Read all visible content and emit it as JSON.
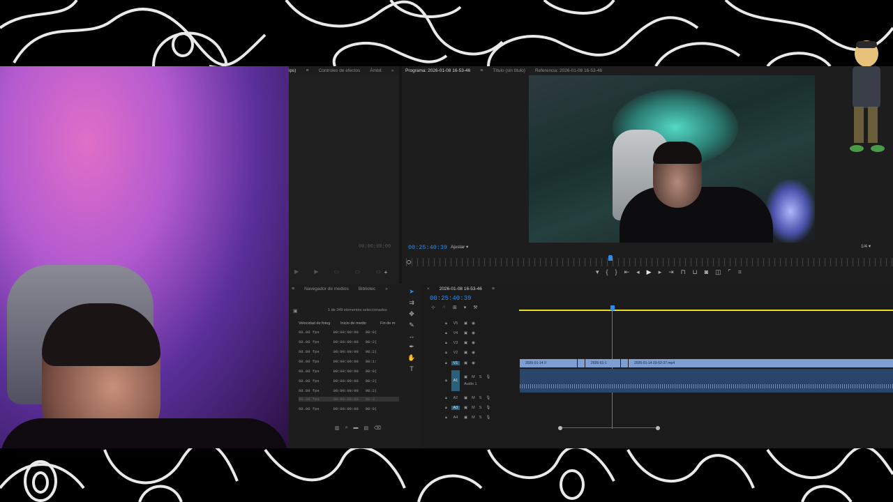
{
  "source": {
    "tabs": [
      "ips)",
      "Controles de efectos",
      "Ámbit"
    ],
    "timecode": "00;00;00;00"
  },
  "program": {
    "tab_program": "Programa: 2026-01-08 16-53-46",
    "tab_title": "Título (sin título)",
    "tab_reference": "Referencia: 2026-01-08 16-53-46",
    "timecode": "00:25:40:39",
    "fit": "Ajustar",
    "resolution": "1/4"
  },
  "project": {
    "tabs": [
      "Navegador de medios",
      "Bibliotec"
    ],
    "selection": "1 de 349 elementos seleccionados",
    "columns": [
      "Velocidad de fotog",
      "Inicio de medio",
      "Fin de m"
    ],
    "rows": [
      {
        "fps": "60.00 fps",
        "start": "00:00:00:00",
        "end": "00:0("
      },
      {
        "fps": "60.00 fps",
        "start": "00:00:00:00",
        "end": "00:2("
      },
      {
        "fps": "60.00 fps",
        "start": "00:00:00:00",
        "end": "00:2("
      },
      {
        "fps": "60.00 fps",
        "start": "00:00:00:00",
        "end": "00:1:"
      },
      {
        "fps": "60.00 fps",
        "start": "00:00:00:00",
        "end": "00:0("
      },
      {
        "fps": "60.00 fps",
        "start": "00:00:00:00",
        "end": "00:2("
      },
      {
        "fps": "60.00 fps",
        "start": "00:00:00:00",
        "end": "00:2("
      },
      {
        "fps": "60.00 fps",
        "start": "00:00:00:00",
        "end": "00:3"
      },
      {
        "fps": "60.00 fps",
        "start": "00:00:00:00",
        "end": "00:0("
      }
    ]
  },
  "timeline": {
    "sequence_name": "2026-01-08 16-53-46",
    "timecode": "00:25:40:39",
    "video_tracks": [
      "V5",
      "V4",
      "V3",
      "V2",
      "V1"
    ],
    "audio_tracks": [
      "A1",
      "A2",
      "A3",
      "A4"
    ],
    "audio1_label": "Audio 1",
    "clips": [
      "2026-01-14 0",
      "2026-01-1",
      "2026-01-14 03-52-37.mp4"
    ]
  },
  "colors": {
    "accent": "#2d8ceb",
    "video_clip": "#7d9fd3",
    "audio_clip": "#29456a",
    "work_area": "#e8e020"
  }
}
